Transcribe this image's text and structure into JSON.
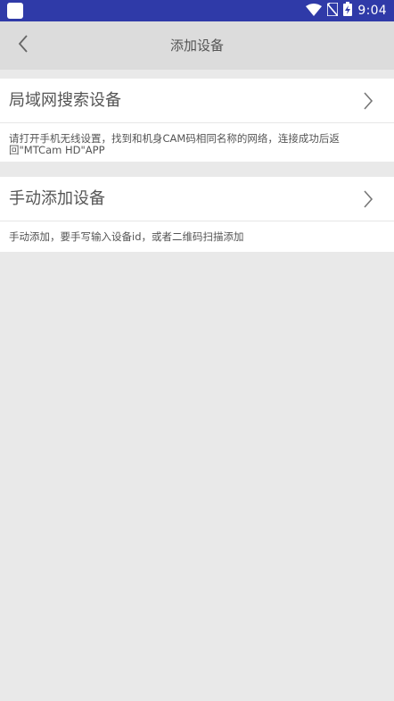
{
  "status_bar": {
    "time": "9:04",
    "icons": [
      "wifi-icon",
      "no-sim-icon",
      "battery-charging-icon"
    ]
  },
  "app_bar": {
    "title": "添加设备",
    "back_icon": "chevron-left-icon"
  },
  "options": [
    {
      "label": "局域网搜索设备",
      "description": "请打开手机无线设置，找到和机身CAM码相同名称的网络，连接成功后返回\"MTCam HD\"APP"
    },
    {
      "label": "手动添加设备",
      "description": "手动添加，要手写输入设备id，或者二维码扫描添加"
    }
  ],
  "colors": {
    "status_bar": "#2f3aa8",
    "app_bar": "#dcdcdc",
    "background": "#e9e9e9",
    "card": "#ffffff"
  }
}
